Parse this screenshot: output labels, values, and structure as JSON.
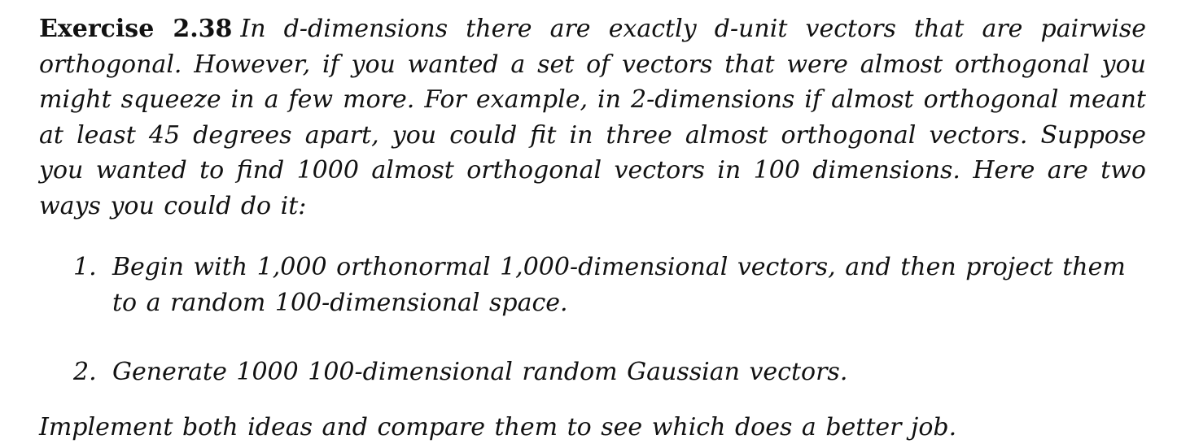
{
  "exercise": {
    "label": "Exercise 2.38",
    "intro": "In d-dimensions there are exactly d-unit vectors that are pairwise orthogonal. However, if you wanted a set of vectors that were almost orthogonal you might squeeze in a few more. For example, in 2-dimensions if almost orthogonal meant at least 45 degrees apart, you could fit in three almost orthogonal vectors. Suppose you wanted to find 1000 almost orthogonal vectors in 100 dimensions. Here are two ways you could do it:",
    "items": [
      {
        "marker": "1.",
        "text": "Begin with 1,000 orthonormal 1,000-dimensional vectors, and then project them to a random 100-dimensional space."
      },
      {
        "marker": "2.",
        "text": "Generate 1000 100-dimensional random Gaussian vectors."
      }
    ],
    "closing": "Implement both ideas and compare them to see which does a better job."
  }
}
